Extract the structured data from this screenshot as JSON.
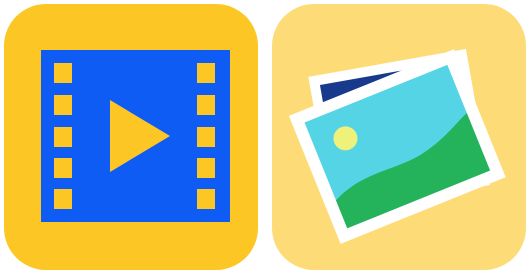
{
  "icons": [
    {
      "name": "video-app-icon",
      "glyph": "film-strip-play",
      "colors": {
        "tile": "#FCC625",
        "film": "#0E5CF4",
        "accent": "#FCC625"
      }
    },
    {
      "name": "photos-app-icon",
      "glyph": "stacked-photos",
      "colors": {
        "tile": "#FDDC78",
        "photo_border": "#FFFFFF",
        "back_photo": "#173A8C",
        "sky": "#55D4E6",
        "sun": "#EEF27A",
        "hill": "#24B25A"
      }
    }
  ]
}
